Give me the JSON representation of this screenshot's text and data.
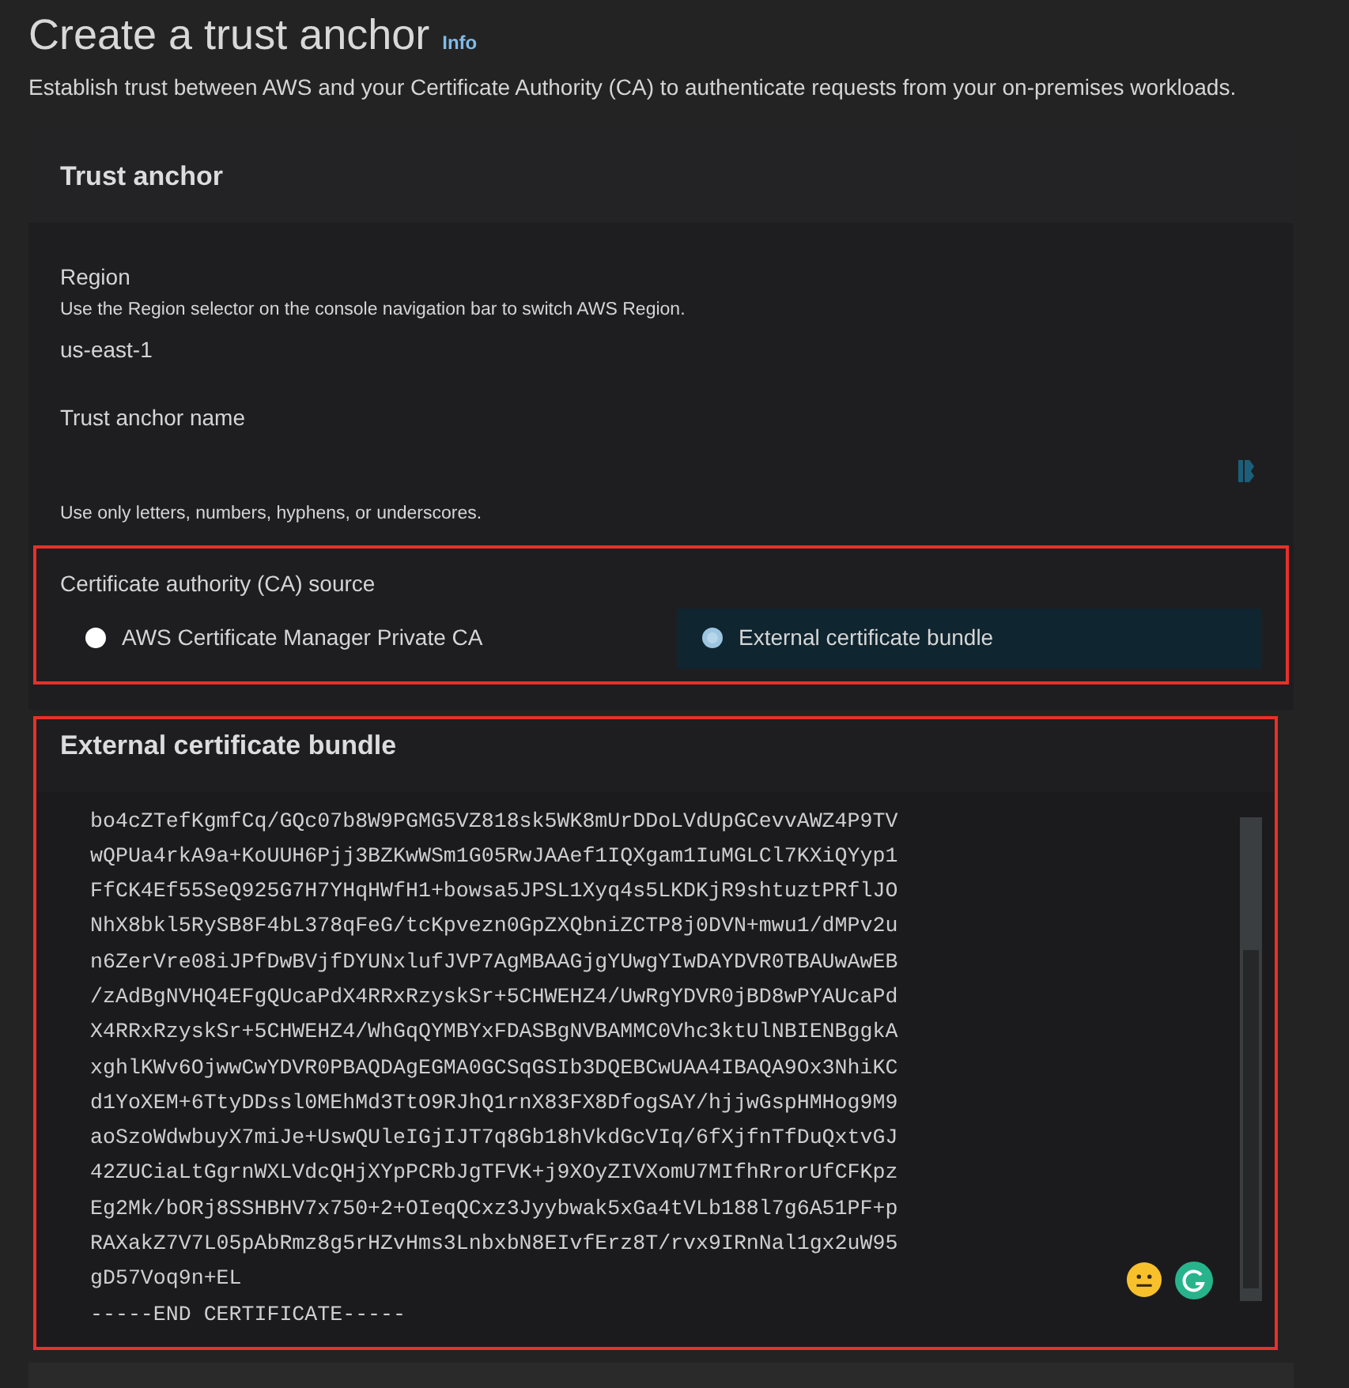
{
  "page": {
    "title": "Create a trust anchor",
    "info_link": "Info",
    "description": "Establish trust between AWS and your Certificate Authority (CA) to authenticate requests from your on-premises workloads."
  },
  "trust_anchor": {
    "title": "Trust anchor",
    "region": {
      "label": "Region",
      "hint": "Use the Region selector on the console navigation bar to switch AWS Region.",
      "value": "us-east-1"
    },
    "name_field": {
      "label": "Trust anchor name",
      "hint": "Use only letters, numbers, hyphens, or underscores."
    },
    "ca_source": {
      "label": "Certificate authority (CA) source",
      "options": [
        {
          "label": "AWS Certificate Manager Private CA",
          "selected": false
        },
        {
          "label": "External certificate bundle",
          "selected": true
        }
      ]
    }
  },
  "bundle": {
    "title": "External certificate bundle",
    "lines": [
      "bo4cZTefKgmfCq/GQc07b8W9PGMG5VZ818sk5WK8mUrDDoLVdUpGCevvAWZ4P9TV",
      "wQPUa4rkA9a+KoUUH6Pjj3BZKwWSm1G05RwJAAef1IQXgam1IuMGLCl7KXiQYyp1",
      "FfCK4Ef55SeQ925G7H7YHqHWfH1+bowsa5JPSL1Xyq4s5LKDKjR9shtuztPRflJO",
      "NhX8bkl5RySB8F4bL378qFeG/tcKpvezn0GpZXQbniZCTP8j0DVN+mwu1/dMPv2u",
      "n6ZerVre08iJPfDwBVjfDYUNxlufJVP7AgMBAAGjgYUwgYIwDAYDVR0TBAUwAwEB",
      "/zAdBgNVHQ4EFgQUcaPdX4RRxRzyskSr+5CHWEHZ4/UwRgYDVR0jBD8wPYAUcaPd",
      "X4RRxRzyskSr+5CHWEHZ4/WhGqQYMBYxFDASBgNVBAMMC0Vhc3ktUlNBIENBggkA",
      "xghlKWv6OjwwCwYDVR0PBAQDAgEGMA0GCSqGSIb3DQEBCwUAA4IBAQA9Ox3NhiKC",
      "d1YoXEM+6TtyDDssl0MEhMd3TtO9RJhQ1rnX83FX8DfogSAY/hjjwGspHMHog9M9",
      "aoSzoWdwbuyX7miJe+UswQUleIGjIJT7q8Gb18hVkdGcVIq/6fXjfnTfDuQxtvGJ",
      "42ZUCiaLtGgrnWXLVdcQHjXYpPCRbJgTFVK+j9XOyZIVXomU7MIfhRrorUfCFKpz",
      "Eg2Mk/bORj8SSHBHV7x750+2+OIeqQCxz3Jyybwak5xGa4tVLb188l7g6A51PF+p",
      "RAXakZ7V7L05pAbRmz8g5rHZvHms3LnbxbN8EIvfErz8T/rvx9IRnNal1gx2uW95",
      "gD57Voq9n+EL",
      "-----END CERTIFICATE-----"
    ]
  }
}
